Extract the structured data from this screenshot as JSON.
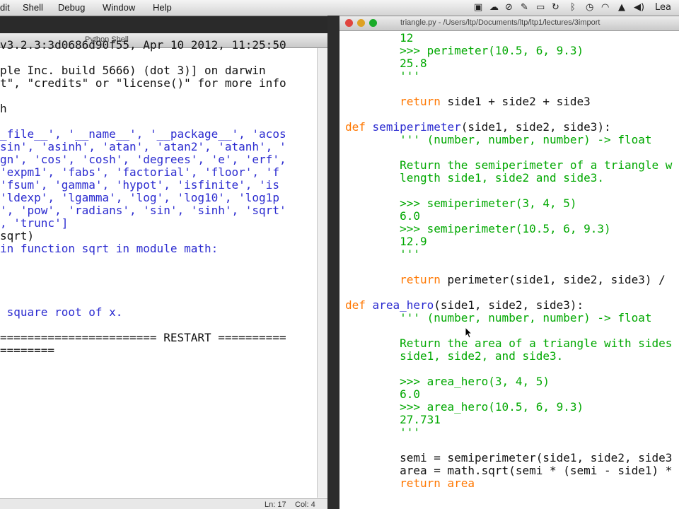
{
  "menubar": {
    "items": [
      "dit",
      "Shell",
      "Debug",
      "Window",
      "Help"
    ],
    "tray_right_text": "Lea"
  },
  "shell_window": {
    "title": "Python Shell",
    "lines": [
      "v3.2.3:3d0686d90f55, Apr 10 2012, 11:25:50",
      "ple Inc. build 5666) (dot 3)] on darwin",
      "t\", \"credits\" or \"license()\" for more info",
      "",
      "h",
      "",
      "_file__', '__name__', '__package__', 'acos",
      "sin', 'asinh', 'atan', 'atan2', 'atanh', '",
      "gn', 'cos', 'cosh', 'degrees', 'e', 'erf',",
      "'expm1', 'fabs', 'factorial', 'floor', 'f",
      "'fsum', 'gamma', 'hypot', 'isfinite', 'is",
      "'ldexp', 'lgamma', 'log', 'log10', 'log1p",
      "', 'pow', 'radians', 'sin', 'sinh', 'sqrt'",
      ", 'trunc']",
      "sqrt)",
      "in function sqrt in module math:",
      "",
      "",
      "",
      " square root of x.",
      "",
      "======================= RESTART ==========",
      "========"
    ],
    "status": {
      "ln": "Ln: 17",
      "col": "Col: 4"
    }
  },
  "editor_window": {
    "title": "triangle.py - /Users/ltp/Documents/ltp/ltp1/lectures/3import",
    "lines": [
      "        12",
      "        >>> perimeter(10.5, 6, 9.3)",
      "        25.8",
      "        '''",
      "",
      "        return side1 + side2 + side3",
      "",
      "def semiperimeter(side1, side2, side3):",
      "        ''' (number, number, number) -> float",
      "",
      "        Return the semiperimeter of a triangle w",
      "        length side1, side2 and side3.",
      "",
      "        >>> semiperimeter(3, 4, 5)",
      "        6.0",
      "        >>> semiperimeter(10.5, 6, 9.3)",
      "        12.9",
      "        '''",
      "",
      "",
      "        return perimeter(side1, side2, side3) /",
      "",
      "def area_hero(side1, side2, side3):",
      "        ''' (number, number, number) -> float",
      "",
      "        Return the area of a triangle with sides",
      "        side1, side2, and side3.",
      "",
      "        >>> area_hero(3, 4, 5)",
      "        6.0",
      "        >>> area_hero(10.5, 6, 9.3)",
      "        27.731",
      "        '''",
      "",
      "",
      "        semi = semiperimeter(side1, side2, side3",
      "        area = math.sqrt(semi * (semi - side1) *",
      "        return area"
    ]
  },
  "colors": {
    "keyword": "#ff7700",
    "definition": "#2b2bd0",
    "string": "#00a800",
    "output": "#2b2bd0"
  }
}
